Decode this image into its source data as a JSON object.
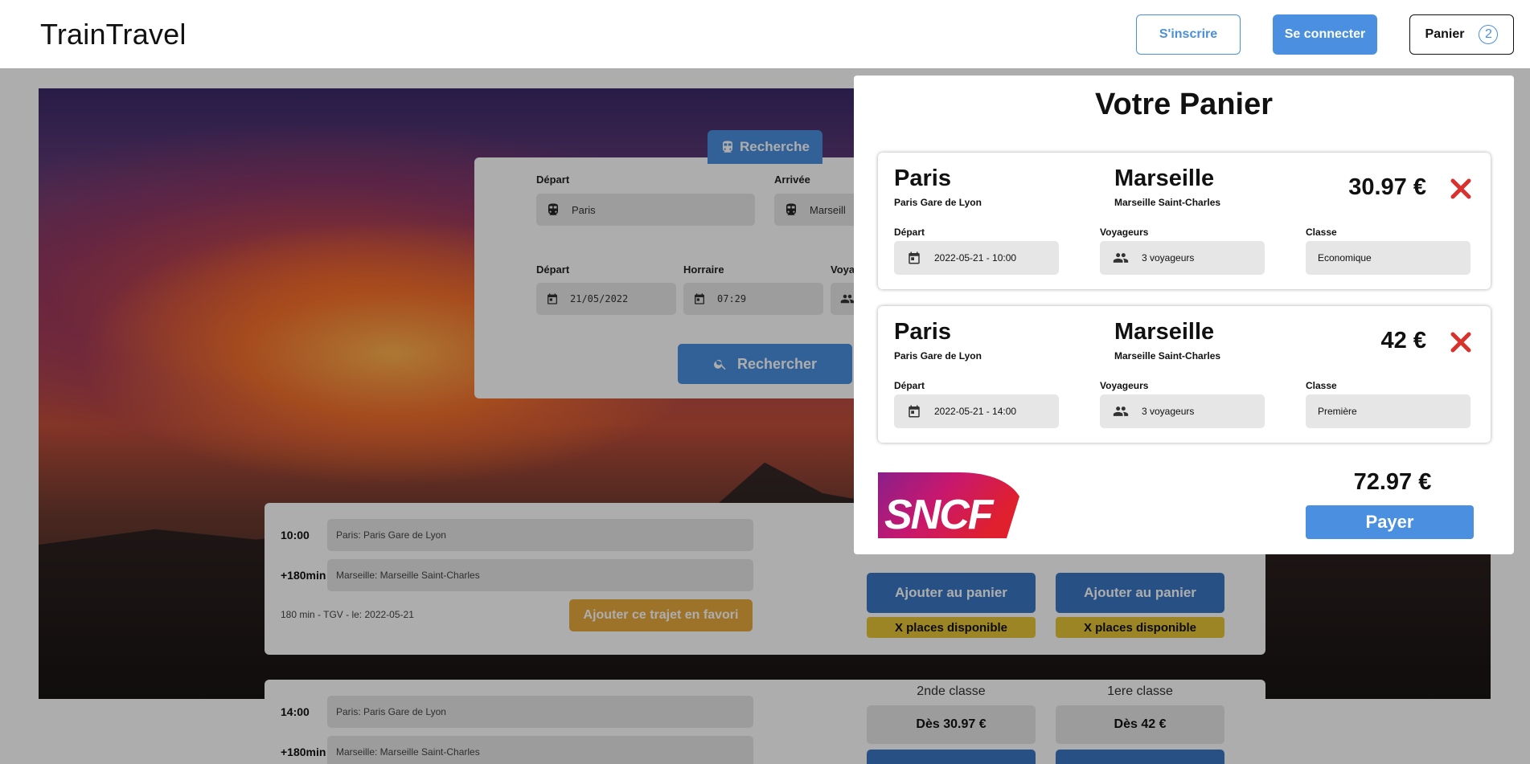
{
  "header": {
    "brand": "TrainTravel",
    "signup_label": "S'inscrire",
    "login_label": "Se connecter",
    "cart_label": "Panier",
    "cart_count": "2"
  },
  "search": {
    "tab_label": "Recherche",
    "depart_label": "Départ",
    "depart_value": "Paris",
    "arrivee_label": "Arrivée",
    "arrivee_value": "Marseill",
    "date_label": "Départ",
    "date_value": "21/05/2022",
    "time_label": "Horraire",
    "time_value": "07:29",
    "voyageurs_label": "Voya",
    "submit_label": "Rechercher"
  },
  "results": [
    {
      "depart_time": "10:00",
      "depart_station": "Paris: Paris Gare de Lyon",
      "arrival_offset": "+180min",
      "arrival_station": "Marseille: Marseille Saint-Charles",
      "meta": "180 min - TGV - le: 2022-05-21",
      "fav_label": "Ajouter ce trajet en favori",
      "add_label": "Ajouter au panier",
      "places_label": "X places disponible"
    },
    {
      "depart_time": "14:00",
      "depart_station": "Paris: Paris Gare de Lyon",
      "arrival_offset": "+180min",
      "arrival_station": "Marseille: Marseille Saint-Charles",
      "class_2_title": "2nde classe",
      "class_2_price": "Dès 30.97 €",
      "class_1_title": "1ere classe",
      "class_1_price": "Dès 42 €"
    }
  ],
  "cart": {
    "title": "Votre Panier",
    "items": [
      {
        "from_city": "Paris",
        "from_station": "Paris Gare de Lyon",
        "to_city": "Marseille",
        "to_station": "Marseille Saint-Charles",
        "price": "30.97 €",
        "depart_label": "Départ",
        "depart_value": "2022-05-21 - 10:00",
        "travellers_label": "Voyageurs",
        "travellers_value": "3 voyageurs",
        "class_label": "Classe",
        "class_value": "Economique"
      },
      {
        "from_city": "Paris",
        "from_station": "Paris Gare de Lyon",
        "to_city": "Marseille",
        "to_station": "Marseille Saint-Charles",
        "price": "42 €",
        "depart_label": "Départ",
        "depart_value": "2022-05-21 - 14:00",
        "travellers_label": "Voyageurs",
        "travellers_value": "3 voyageurs",
        "class_label": "Classe",
        "class_value": "Première"
      }
    ],
    "total": "72.97 €",
    "pay_label": "Payer",
    "logo_text": "SNCF"
  },
  "colors": {
    "accent": "#4a8fe0",
    "favorite": "#e8a93d",
    "places": "#e6c536",
    "remove": "#d9322c"
  }
}
